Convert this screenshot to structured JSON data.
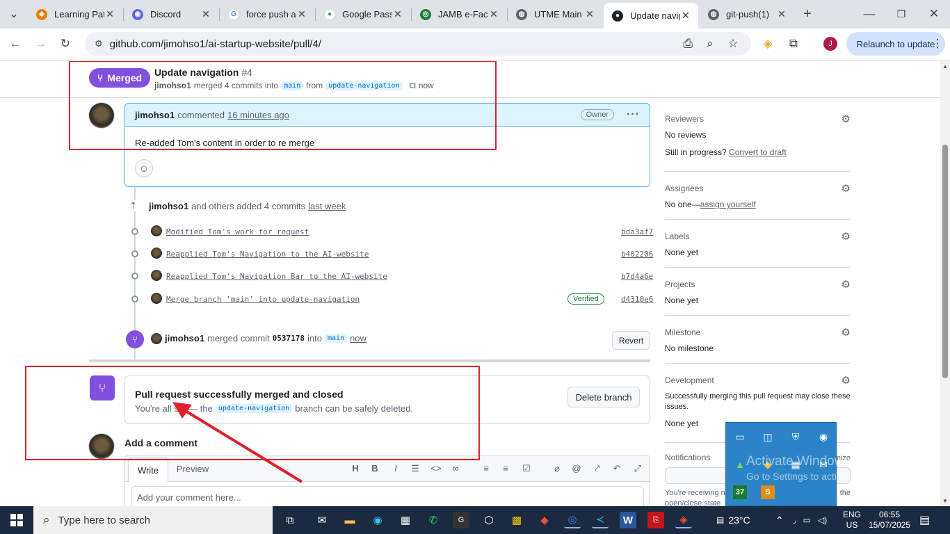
{
  "browser": {
    "tabs": [
      {
        "title": "Learning Pat",
        "icon": "learning-icon",
        "color": "#f57c00"
      },
      {
        "title": "Discord",
        "icon": "discord-icon",
        "color": "#5865f2"
      },
      {
        "title": "force push a",
        "icon": "google-icon",
        "color": "#4285f4"
      },
      {
        "title": "Google Pass",
        "icon": "google-password-icon",
        "color": "#34a853"
      },
      {
        "title": "JAMB e-Facil",
        "icon": "jamb-icon",
        "color": "#1b7f3a"
      },
      {
        "title": "UTME Main",
        "icon": "globe-icon",
        "color": "#5f6368"
      },
      {
        "title": "Update navig",
        "icon": "github-icon",
        "color": "#1f2328"
      },
      {
        "title": "git-push(1)",
        "icon": "globe-icon",
        "color": "#5f6368"
      }
    ],
    "url": "github.com/jimohso1/ai-startup-website/pull/4/",
    "relaunch_label": "Relaunch to update",
    "profile_initial": "J"
  },
  "header": {
    "status": "Merged",
    "title": "Update navigation",
    "number": "#4",
    "author": "jimohso1",
    "merged_text": "merged 4 commits into",
    "base_branch": "main",
    "from_text": "from",
    "head_branch": "update-navigation",
    "time": "now"
  },
  "comment": {
    "author": "jimohso1",
    "action": "commented",
    "time": "16 minutes ago",
    "role": "Owner",
    "body": "Re-added Tom's content in order to re merge"
  },
  "commits_event": {
    "author": "jimohso1",
    "text": "and others added 4 commits",
    "time": "last week",
    "commits": [
      {
        "message": "Modified Tom's work for request",
        "sha": "bda3af7",
        "verified": ""
      },
      {
        "message": "Reapplied Tom's Navigation to the AI-website",
        "sha": "b402206",
        "verified": ""
      },
      {
        "message": "Reapplied Tom's Navigation Bar to the AI-website",
        "sha": "b7d4a6e",
        "verified": ""
      },
      {
        "message": "Merge branch 'main' into update-navigation",
        "sha": "d4310e6",
        "verified": "Verified"
      }
    ]
  },
  "merge_event": {
    "author": "jimohso1",
    "text": "merged commit",
    "sha": "0537178",
    "into": "into",
    "branch": "main",
    "time": "now",
    "revert_label": "Revert"
  },
  "merge_box": {
    "title": "Pull request successfully merged and closed",
    "text_before": "You're all set — the",
    "branch": "update-navigation",
    "text_after": "branch can be safely deleted.",
    "delete_label": "Delete branch"
  },
  "add_comment": {
    "title": "Add a comment",
    "write_tab": "Write",
    "preview_tab": "Preview",
    "placeholder": "Add your comment here..."
  },
  "sidebar": {
    "reviewers": {
      "heading": "Reviewers",
      "value": "No reviews",
      "progress_text": "Still in progress?",
      "progress_link": "Convert to draft"
    },
    "assignees": {
      "heading": "Assignees",
      "value": "No one—",
      "link": "assign yourself"
    },
    "labels": {
      "heading": "Labels",
      "value": "None yet"
    },
    "projects": {
      "heading": "Projects",
      "value": "None yet"
    },
    "milestone": {
      "heading": "Milestone",
      "value": "No milestone"
    },
    "development": {
      "heading": "Development",
      "desc": "Successfully merging this pull request may close these issues.",
      "value": "None yet"
    },
    "notifications": {
      "heading": "Notifications",
      "customize": "mize",
      "receiving": "You're receiving no",
      "state": "open/close state",
      "the": "the"
    }
  },
  "tray": {
    "badge": "37",
    "watermark_title": "Activate Windows",
    "watermark_sub": "Go to Settings to activate Windows."
  },
  "taskbar": {
    "search_placeholder": "Type here to search",
    "temperature": "23°C",
    "lang": "ENG",
    "region": "US",
    "time": "06:55",
    "date": "15/07/2025"
  },
  "colors": {
    "merged": "#8250df",
    "link": "#0969da",
    "annotation": "#e0202a"
  }
}
